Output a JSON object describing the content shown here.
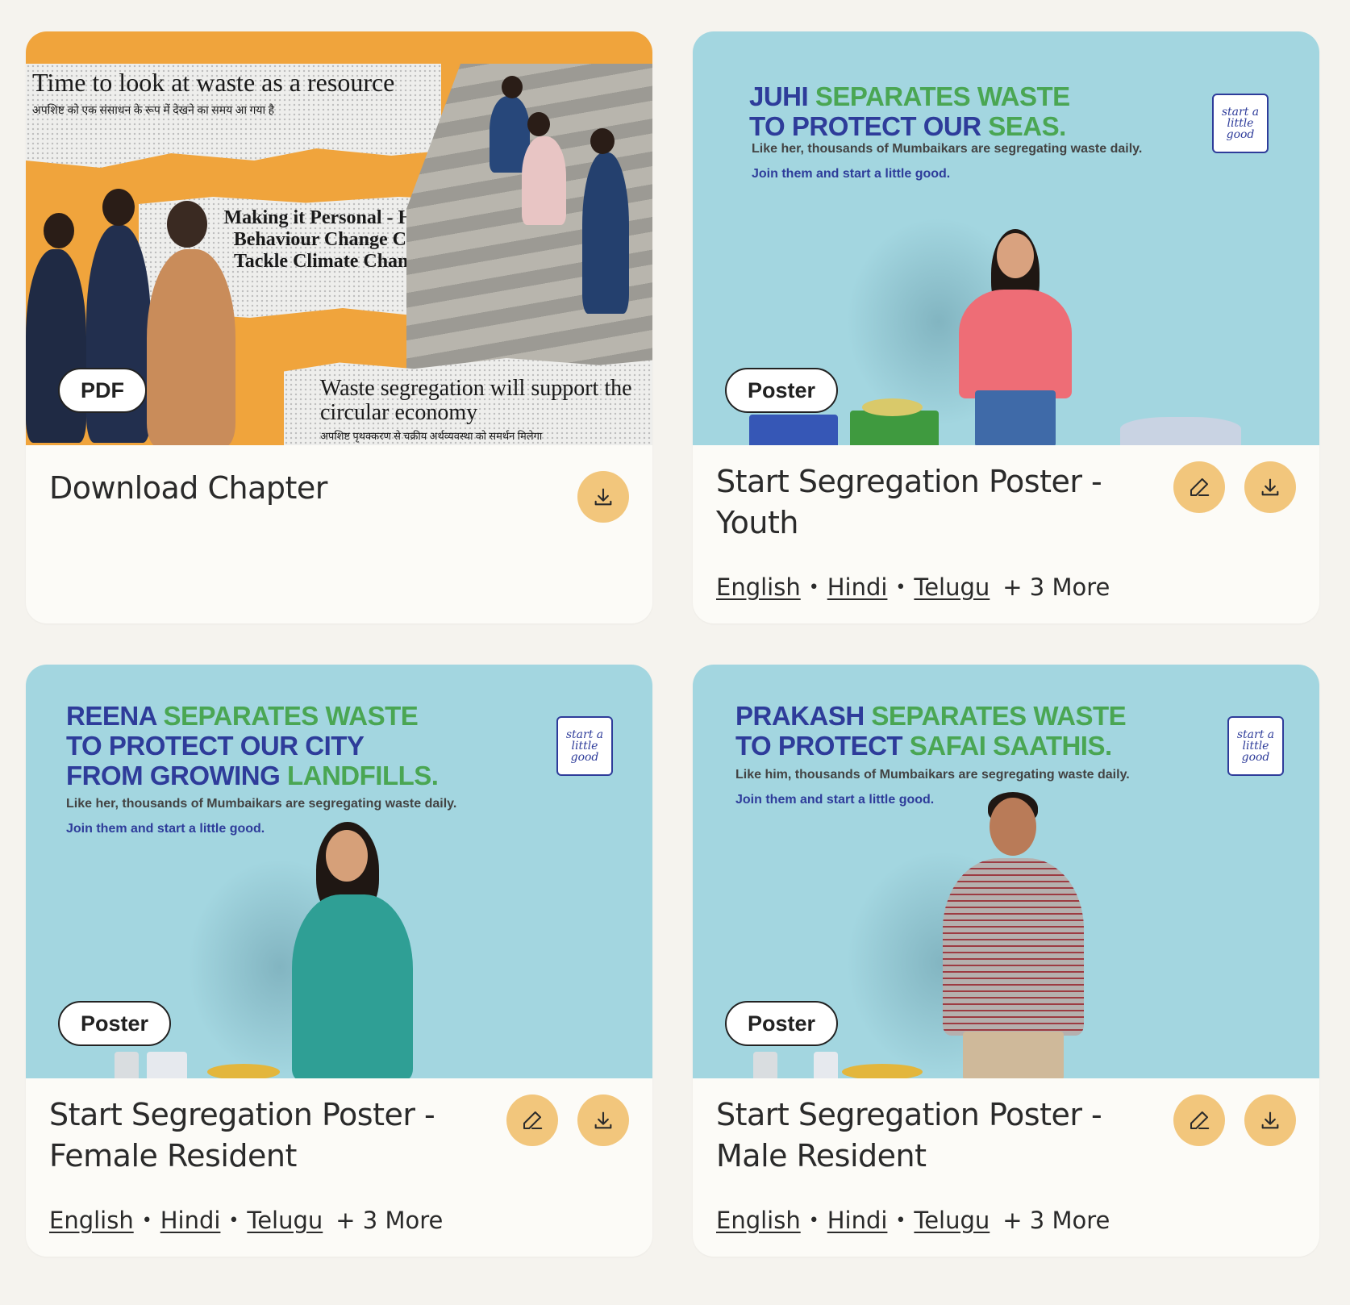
{
  "cards": [
    {
      "title": "Download Chapter",
      "badge": "PDF",
      "thumb": {
        "headline_1": "Time to look at waste as a resource",
        "hindi_1": "अपशिष्ट को एक संसाधन के रूप में देखने का समय आ गया है",
        "headline_2": "Making it Personal - How Behaviour Change Can Tackle Climate Change",
        "headline_3": "Waste segregation will support the circular economy",
        "hindi_3": "अपशिष्ट पृथक्करण से चक्रीय अर्थव्यवस्था को समर्थन मिलेगा"
      },
      "actions": [
        "download-icon"
      ]
    },
    {
      "title": "Start Segregation Poster - Youth",
      "badge": "Poster",
      "thumb": {
        "name": "JUHI",
        "line1_rest": "SEPARATES WASTE",
        "line2_blue": "TO PROTECT OUR",
        "line2_green": "SEAS.",
        "sub": "Like her, thousands of Mumbaikars are segregating waste daily.",
        "join": "Join them and start a little good.",
        "logo": "start a little good"
      },
      "languages": [
        "English",
        "Hindi",
        "Telugu"
      ],
      "more": "+ 3 More",
      "actions": [
        "pencil-icon",
        "download-icon"
      ]
    },
    {
      "title": "Start Segregation Poster - Female Resident",
      "badge": "Poster",
      "thumb": {
        "name": "REENA",
        "line1_rest": "SEPARATES WASTE",
        "line2_blue": "TO PROTECT OUR CITY",
        "line3_blue": "FROM GROWING",
        "line3_green": "LANDFILLS.",
        "sub": "Like her, thousands of Mumbaikars are segregating waste daily.",
        "join": "Join them and start a little good.",
        "logo": "start a little good"
      },
      "languages": [
        "English",
        "Hindi",
        "Telugu"
      ],
      "more": "+ 3 More",
      "actions": [
        "pencil-icon",
        "download-icon"
      ]
    },
    {
      "title": "Start Segregation Poster - Male Resident",
      "badge": "Poster",
      "thumb": {
        "name": "PRAKASH",
        "line1_rest": "SEPARATES WASTE",
        "line2_blue": "TO PROTECT",
        "line2_green": "SAFAI SAATHIS.",
        "sub": "Like him, thousands of Mumbaikars are segregating waste daily.",
        "join": "Join them and start a little good.",
        "logo": "start a little good"
      },
      "languages": [
        "English",
        "Hindi",
        "Telugu"
      ],
      "more": "+ 3 More",
      "actions": [
        "pencil-icon",
        "download-icon"
      ]
    }
  ],
  "colors": {
    "page_bg": "#f5f3ee",
    "card_bg": "#fcfbf7",
    "icon_button": "#f2c67c",
    "poster_bg": "#a3d6e0",
    "pdf_bg": "#f0a43c",
    "brand_blue": "#2e3c9a",
    "brand_green": "#4aa653"
  }
}
